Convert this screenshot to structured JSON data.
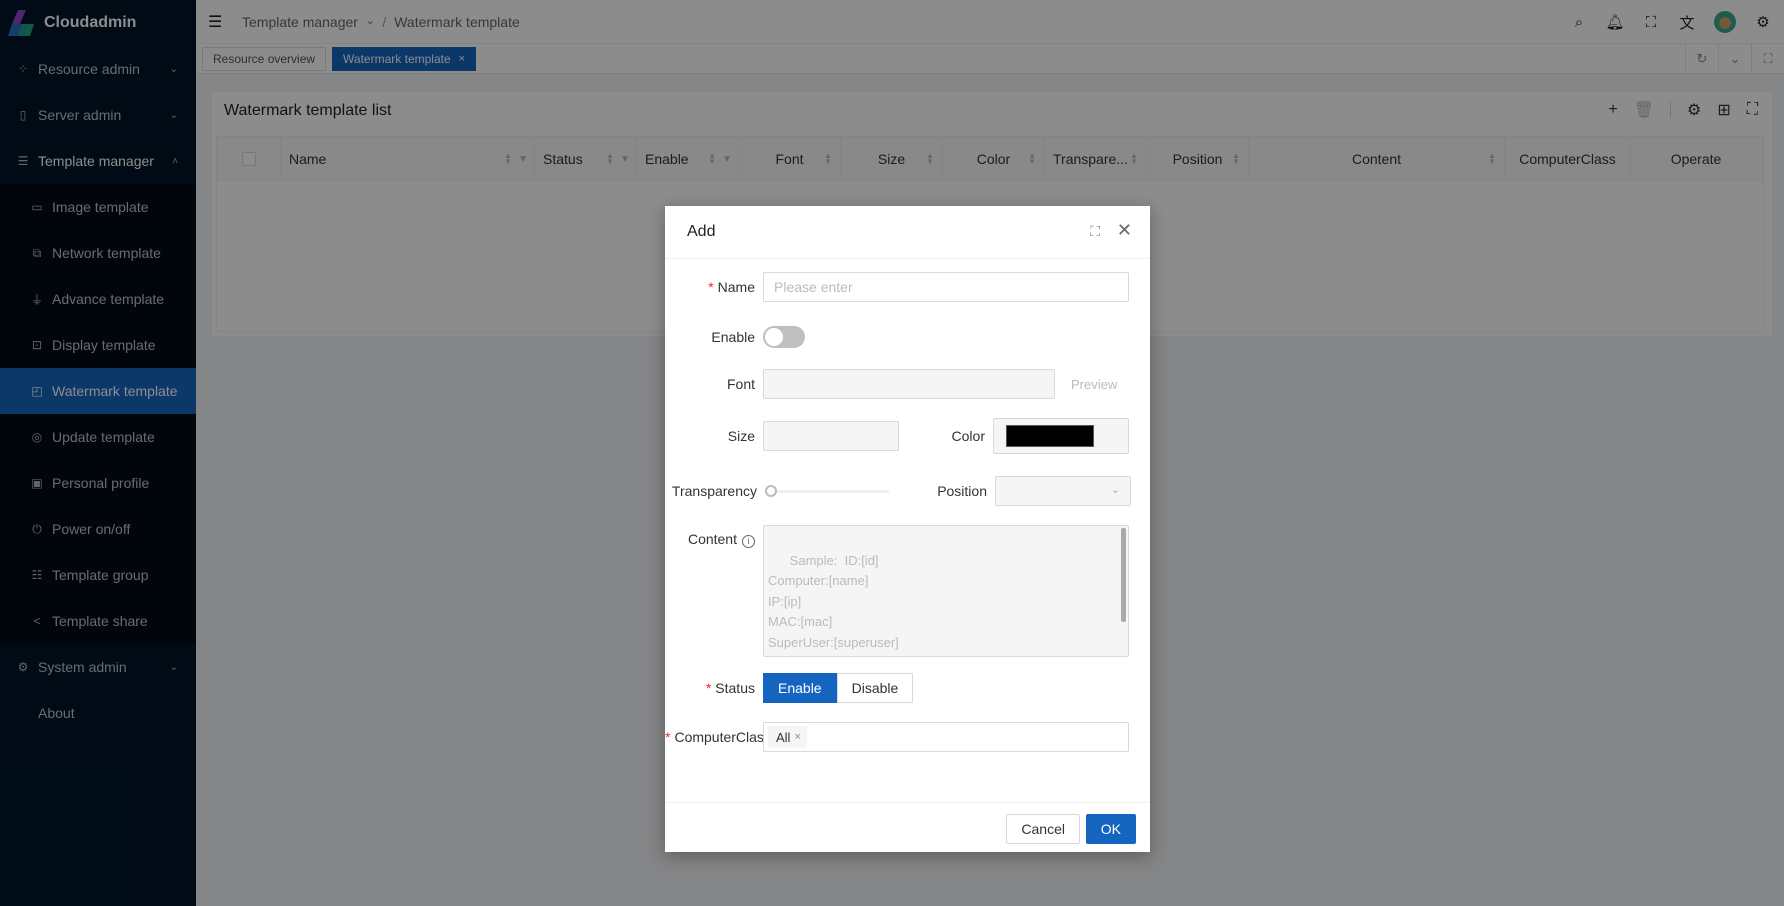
{
  "app": {
    "name": "Cloudadmin"
  },
  "sidebar": {
    "items": [
      {
        "label": "Resource admin",
        "icon": "resource-icon",
        "expandable": true
      },
      {
        "label": "Server admin",
        "icon": "server-icon",
        "expandable": true
      },
      {
        "label": "Template manager",
        "icon": "template-icon",
        "expandable": true,
        "open": true,
        "children": [
          {
            "label": "Image template",
            "icon": "disk-icon"
          },
          {
            "label": "Network template",
            "icon": "network-icon"
          },
          {
            "label": "Advance template",
            "icon": "advance-icon"
          },
          {
            "label": "Display template",
            "icon": "display-icon"
          },
          {
            "label": "Watermark template",
            "icon": "watermark-icon",
            "active": true
          },
          {
            "label": "Update template",
            "icon": "update-icon"
          },
          {
            "label": "Personal profile",
            "icon": "profile-icon"
          },
          {
            "label": "Power on/off",
            "icon": "power-icon"
          },
          {
            "label": "Template group",
            "icon": "list-icon"
          },
          {
            "label": "Template share",
            "icon": "share-icon"
          }
        ]
      },
      {
        "label": "System admin",
        "icon": "gear-icon",
        "expandable": true
      },
      {
        "label": "About",
        "icon": "",
        "expandable": false
      }
    ]
  },
  "header": {
    "breadcrumb": [
      "Template manager",
      "Watermark template"
    ],
    "icons": [
      "search-icon",
      "bell-icon",
      "fullscreen-icon",
      "translate-icon",
      "avatar",
      "settings-icon"
    ]
  },
  "tabs": [
    {
      "label": "Resource overview",
      "active": false
    },
    {
      "label": "Watermark template",
      "active": true,
      "closable": true
    }
  ],
  "card": {
    "title": "Watermark template list",
    "columns": [
      "Name",
      "Status",
      "Enable",
      "Font",
      "Size",
      "Color",
      "Transpare...",
      "Position",
      "Content",
      "ComputerClass",
      "Operate"
    ]
  },
  "modal": {
    "title": "Add",
    "name": {
      "label": "Name",
      "placeholder": "Please enter",
      "value": "",
      "required": true
    },
    "enable": {
      "label": "Enable",
      "on": false
    },
    "font": {
      "label": "Font",
      "value": "",
      "preview_label": "Preview"
    },
    "size": {
      "label": "Size",
      "value": ""
    },
    "color": {
      "label": "Color",
      "value": "#000000"
    },
    "transparency": {
      "label": "Transparency",
      "value": 0
    },
    "position": {
      "label": "Position",
      "value": ""
    },
    "content": {
      "label": "Content",
      "placeholder": "Sample:  ID:[id]\nComputer:[name]\nIP:[ip]\nMAC:[mac]\nSuperUser:[superuser]\nBootMode:[bootmode]"
    },
    "status": {
      "label": "Status",
      "required": true,
      "options": [
        "Enable",
        "Disable"
      ],
      "selected": "Enable"
    },
    "computer_class": {
      "label": "ComputerClas:",
      "required": true,
      "tags": [
        "All"
      ]
    },
    "cancel_label": "Cancel",
    "ok_label": "OK"
  },
  "colors": {
    "primary": "#1565c0",
    "sidebar_bg": "#001529",
    "required": "#f5222d"
  }
}
